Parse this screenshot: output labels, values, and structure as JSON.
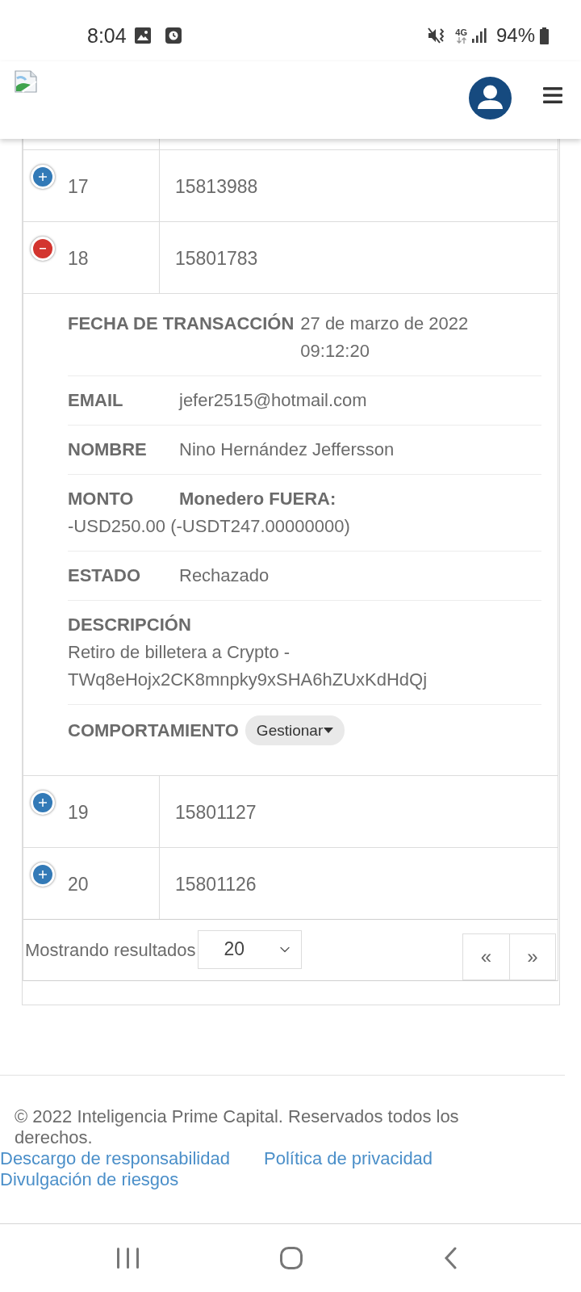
{
  "status_bar": {
    "time": "8:04",
    "network": "4G",
    "battery": "94%"
  },
  "table": {
    "rows": [
      {
        "number": "17",
        "id": "15813988",
        "expanded": false
      },
      {
        "number": "18",
        "id": "15801783",
        "expanded": true,
        "details": [
          {
            "kind": "inline",
            "label": "FECHA DE TRANSACCIÓN",
            "value": "27 de marzo de 2022 09:12:20"
          },
          {
            "kind": "inline",
            "label": "EMAIL",
            "value": "jefer2515@hotmail.com"
          },
          {
            "kind": "inline",
            "label": "NOMBRE",
            "value": "Nino Hernández Jeffersson"
          },
          {
            "kind": "amount",
            "label": "MONTO",
            "heading": "Monedero FUERA:",
            "value": "-USD250.00 (-USDT247.00000000)"
          },
          {
            "kind": "inline",
            "label": "ESTADO",
            "value": "Rechazado"
          },
          {
            "kind": "block",
            "label": "DESCRIPCIÓN",
            "value": "Retiro de billetera a Crypto - TWq8eHojx2CK8mnpky9xSHA6hZUxKdHdQj"
          },
          {
            "kind": "action",
            "label": "COMPORTAMIENTO",
            "button": "Gestionar"
          }
        ]
      },
      {
        "number": "19",
        "id": "15801127",
        "expanded": false
      },
      {
        "number": "20",
        "id": "15801126",
        "expanded": false
      }
    ]
  },
  "pagination": {
    "label": "Mostrando resultados",
    "page_size": "20",
    "prev": "«",
    "next": "»"
  },
  "footer": {
    "copyright": "© 2022 Inteligencia Prime Capital. Reservados todos los derechos.",
    "links": [
      "Descargo de responsabilidad",
      "Política de privacidad",
      "Divulgación de riesgos"
    ]
  }
}
